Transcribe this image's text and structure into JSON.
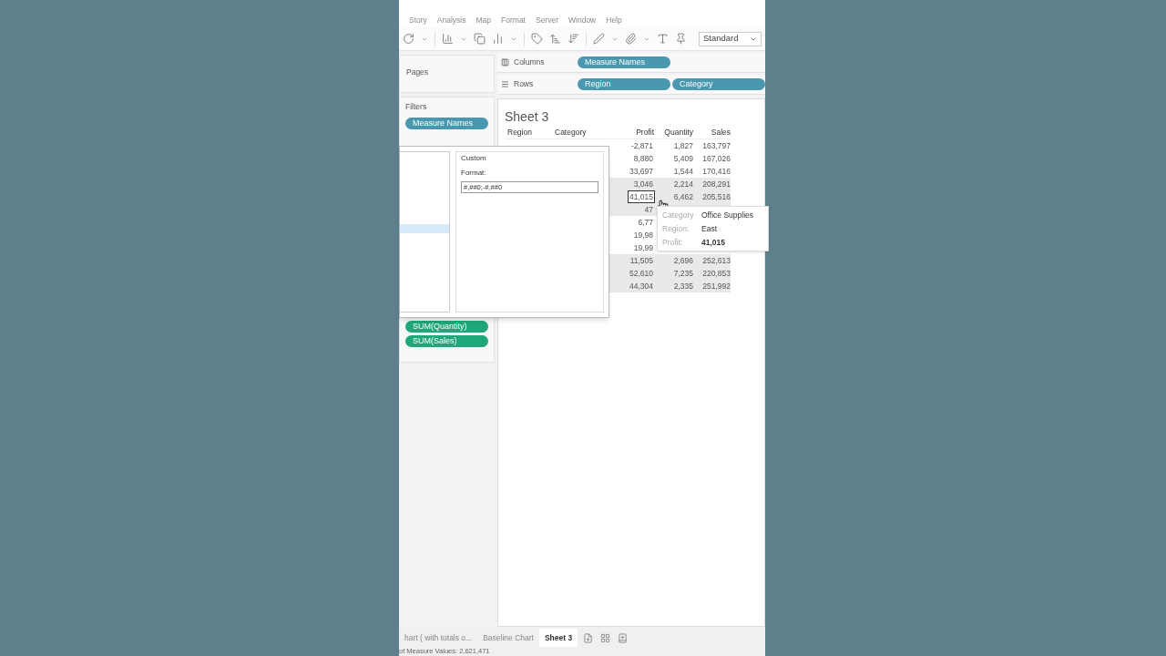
{
  "menu": [
    "Story",
    "Analysis",
    "Map",
    "Format",
    "Server",
    "Window",
    "Help"
  ],
  "toolbar": {
    "view_mode": "Standard"
  },
  "pages": {
    "title": "Pages"
  },
  "columns_shelf": {
    "label": "Columns",
    "pills": [
      "Measure Names"
    ]
  },
  "rows_shelf": {
    "label": "Rows",
    "pills": [
      "Region",
      "Category"
    ]
  },
  "filters": {
    "title": "Filters",
    "pills": [
      "Measure Names"
    ]
  },
  "measure_values": [
    "SUM(Quantity)",
    "SUM(Sales)"
  ],
  "format_dialog": {
    "group": "Custom",
    "field_label": "Format:",
    "value": "#,##0;-#,##0"
  },
  "sheet": {
    "title": "Sheet 3",
    "headers": [
      "Region",
      "Category",
      "Profit",
      "Quantity",
      "Sales"
    ],
    "rows": [
      {
        "profit": "-2,871",
        "quantity": "1,827",
        "sales": "163,797",
        "shaded": false,
        "selected": false
      },
      {
        "profit": "8,880",
        "quantity": "5,409",
        "sales": "167,026",
        "shaded": false,
        "selected": false
      },
      {
        "profit": "33,697",
        "quantity": "1,544",
        "sales": "170,416",
        "shaded": false,
        "selected": false
      },
      {
        "profit": "3,046",
        "quantity": "2,214",
        "sales": "208,291",
        "shaded": true,
        "selected": false
      },
      {
        "profit": "41,015",
        "quantity": "6,462",
        "sales": "205,516",
        "shaded": true,
        "selected": true
      },
      {
        "profit": "47",
        "shaded": true,
        "selected": false
      },
      {
        "profit": "6,77",
        "shaded": false,
        "selected": false
      },
      {
        "profit": "19,98",
        "shaded": false,
        "selected": false
      },
      {
        "profit": "19,99",
        "shaded": false,
        "selected": false
      },
      {
        "profit": "11,505",
        "quantity": "2,696",
        "sales": "252,613",
        "shaded": true,
        "selected": false
      },
      {
        "profit": "52,610",
        "quantity": "7,235",
        "sales": "220,853",
        "shaded": true,
        "selected": false
      },
      {
        "profit": "44,304",
        "quantity": "2,335",
        "sales": "251,992",
        "shaded": true,
        "selected": false
      }
    ]
  },
  "tooltip": [
    {
      "label": "Category",
      "value": "Office Supplies"
    },
    {
      "label": "Region:",
      "value": "East"
    },
    {
      "label": "Profit:",
      "value": "41,015"
    }
  ],
  "sheet_tabs": [
    {
      "label": "hart ( with totals o...",
      "selected": false
    },
    {
      "label": "Baseline Chart",
      "selected": false
    },
    {
      "label": "Sheet 3",
      "selected": true
    }
  ],
  "status_bar": "of Measure Values: 2,621,471"
}
